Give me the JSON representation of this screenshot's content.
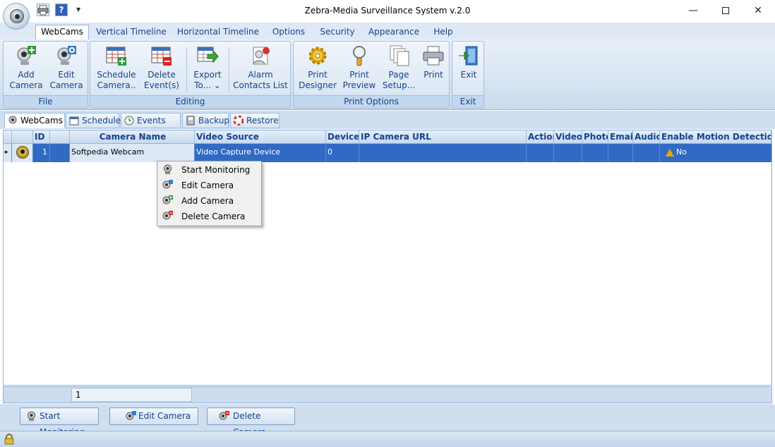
{
  "window": {
    "title": "Zebra-Media Surveillance System v.2.0",
    "min_glyph": "—",
    "close_glyph": "✕",
    "help_glyph": "?",
    "qa_arrow": "▼"
  },
  "ribbon_tabs": [
    "WebCams",
    "Vertical Timeline",
    "Horizontal Timeline",
    "Options",
    "Security",
    "Appearance",
    "Help"
  ],
  "ribbon": {
    "groups": {
      "file": "File",
      "editing": "Editing",
      "print_options": "Print Options",
      "exit": "Exit"
    },
    "buttons": {
      "add_camera": [
        "Add",
        "Camera"
      ],
      "edit_camera": [
        "Edit",
        "Camera"
      ],
      "schedule_camera": [
        "Schedule",
        "Camera.."
      ],
      "delete_events": [
        "Delete",
        "Event(s) ⌄"
      ],
      "export_to": [
        "Export",
        "To... ⌄"
      ],
      "alarm_contacts": [
        "Alarm",
        "Contacts List"
      ],
      "print_designer": [
        "Print",
        "Designer"
      ],
      "print_preview": [
        "Print",
        "Preview"
      ],
      "page_setup": [
        "Page",
        "Setup..."
      ],
      "print": [
        "Print",
        ""
      ],
      "exit": [
        "Exit",
        ""
      ]
    }
  },
  "doc_tabs": [
    "WebCams",
    "Scheduler",
    "Events List",
    "Backup",
    "Restore"
  ],
  "grid": {
    "columns": [
      "ID",
      "Camera Name",
      "Video Source",
      "Device",
      "IP Camera URL",
      "Action",
      "Video",
      "Photo",
      "Email",
      "Audio",
      "Enable Motion Detection"
    ],
    "rows": [
      {
        "row_marker": "▸",
        "id": "1",
        "camera_name": "Softpedia Webcam",
        "video_source": "Video Capture Device",
        "device": "0",
        "ip_url": "",
        "action": "",
        "video": "",
        "photo": "",
        "email": "",
        "audio": "",
        "motion_detection": "No"
      }
    ]
  },
  "context_menu": [
    "Start Monitoring",
    "Edit Camera",
    "Add Camera",
    "Delete Camera"
  ],
  "navigator": {
    "value": "1"
  },
  "actions": {
    "start_monitoring": "Start Monitoring",
    "edit_camera": "Edit Camera",
    "delete_camera": "Delete Camera"
  },
  "colors": {
    "selection": "#316ac5",
    "ribbon_text": "#15428b"
  }
}
